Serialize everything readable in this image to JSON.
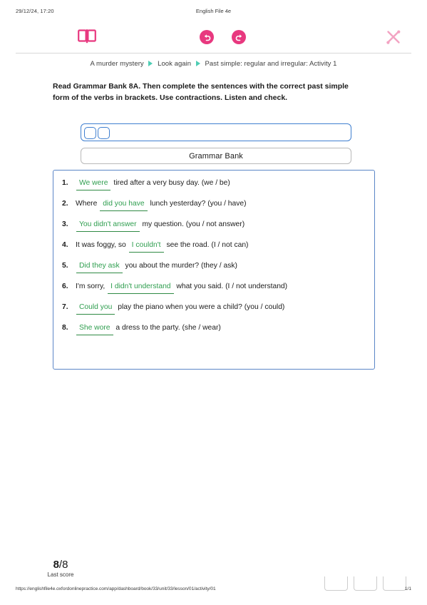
{
  "print_header": {
    "date": "29/12/24, 17:20",
    "title": "English File 4e"
  },
  "toolbar": {
    "book_icon": "open-book-icon",
    "undo_icon": "undo-arrow-icon",
    "redo_icon": "redo-arrow-icon",
    "wand_icon": "magic-wand-pencil-icon",
    "accent_color": "#e8387f",
    "wand_color": "#f3a3c2"
  },
  "breadcrumb": {
    "separator_color": "#4ecdb4",
    "items": [
      "A murder mystery",
      "Look again",
      "Past simple: regular and irregular: Activity 1"
    ]
  },
  "instruction": "Read Grammar Bank 8A. Then complete the sentences with the correct past simple form of the verbs in brackets. Use contractions. Listen and check.",
  "controls": {
    "audio_bar_label": "",
    "grammar_bank_label": "Grammar Bank",
    "border_color": "#3f7fd0"
  },
  "exercise": {
    "answer_color": "#2f9e4f",
    "panel_border": "#5b86c7",
    "items": [
      {
        "num": "1.",
        "pre": "",
        "answer": "We were",
        "post": "tired after a very busy day. (we / be)"
      },
      {
        "num": "2.",
        "pre": "Where",
        "answer": "did you have",
        "post": "lunch yesterday? (you / have)"
      },
      {
        "num": "3.",
        "pre": "",
        "answer": "You didn't answer",
        "post": "my question. (you / not answer)"
      },
      {
        "num": "4.",
        "pre": "It was foggy, so",
        "answer": "I couldn't",
        "post": "see the road. (I / not can)"
      },
      {
        "num": "5.",
        "pre": "",
        "answer": "Did they ask",
        "post": "you about the murder? (they / ask)"
      },
      {
        "num": "6.",
        "pre": "I'm sorry,",
        "answer": "I didn't understand",
        "post": "what you said. (I / not understand)"
      },
      {
        "num": "7.",
        "pre": "",
        "answer": "Could you",
        "post": "play the piano when you were a child? (you / could)"
      },
      {
        "num": "8.",
        "pre": "",
        "answer": "She wore",
        "post": "a dress to the party. (she / wear)"
      }
    ]
  },
  "score": {
    "value": "8",
    "separator": "/8",
    "label": "Last score"
  },
  "print_footer": {
    "url": "https://englishfile4e.oxfordonlinepractice.com/app/dashboard/book/33/unit/33/lesson/01/activity/01",
    "page": "1/1"
  }
}
